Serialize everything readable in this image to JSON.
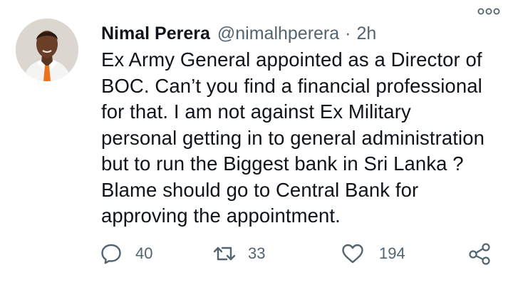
{
  "author": {
    "name": "Nimal Perera",
    "handle": "@nimalhperera",
    "separator": "·",
    "time": "2h"
  },
  "tweet": {
    "text": "Ex Army General appointed as a Director of\nBOC. Can’t you find a financial professional\nfor that. I am not against Ex Military\npersonal getting in to general administration\nbut to run the Biggest bank in Sri Lanka ?\nBlame should go to Central Bank for\napproving the appointment."
  },
  "actions": {
    "replies": "40",
    "retweets": "33",
    "likes": "194"
  },
  "icons": {
    "reply": "reply-icon",
    "retweet": "retweet-icon",
    "like": "like-icon",
    "share": "share-icon",
    "more": "more-icon"
  },
  "colors": {
    "text": "#0f1419",
    "secondary": "#536471",
    "background": "#ffffff"
  }
}
